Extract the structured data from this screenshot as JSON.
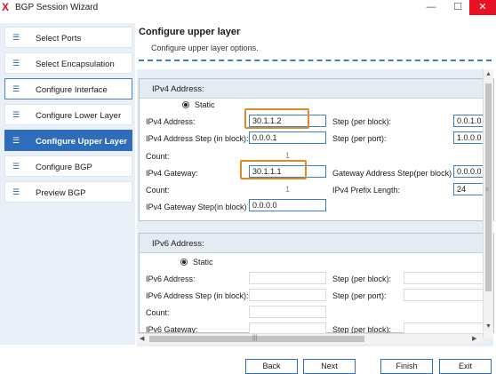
{
  "window": {
    "title": "BGP Session Wizard",
    "app_icon": "X",
    "minimize": "—",
    "maximize": "☐",
    "close": "✕"
  },
  "sidebar": {
    "items": [
      {
        "label": "Select Ports",
        "icon": "list-icon"
      },
      {
        "label": "Select Encapsulation",
        "icon": "list-icon"
      },
      {
        "label": "Configure Interface",
        "icon": "list-icon"
      },
      {
        "label": "Configure Lower Layer",
        "icon": "list-icon"
      },
      {
        "label": "Configure Upper Layer",
        "icon": "list-icon"
      },
      {
        "label": "Configure BGP",
        "icon": "list-icon"
      },
      {
        "label": "Preview BGP",
        "icon": "list-icon"
      }
    ],
    "icon_glyph": "☰",
    "active_index": 4
  },
  "header": {
    "title": "Configure upper layer",
    "subtitle": "Configure upper layer options."
  },
  "ipv4": {
    "title": "IPv4 Address:",
    "mode": "Static",
    "address_label": "IPv4 Address:",
    "address_value": "30.1.1.2",
    "step_block_label": "Step (per block):",
    "step_block_value": "0.0.1.0",
    "addr_step_inblock_label": "IPv4 Address Step (in block):",
    "addr_step_inblock_value": "0.0.0.1",
    "step_port_label": "Step (per port):",
    "step_port_value": "1.0.0.0",
    "count_label": "Count:",
    "count_value": "1",
    "gateway_label": "IPv4 Gateway:",
    "gateway_value": "30.1.1.1",
    "gw_step_block_label": "Gateway Address Step(per block)",
    "gw_step_block_value": "0.0.0.0",
    "count2_label": "Count:",
    "count2_value": "1",
    "prefix_label": "IPv4 Prefix Length:",
    "prefix_value": "24",
    "gw_step_inblock_label": "IPv4 Gateway Step(in block)",
    "gw_step_inblock_value": "0.0.0.0"
  },
  "ipv6": {
    "title": "IPv6 Address:",
    "mode": "Static",
    "address_label": "IPv6 Address:",
    "step_block_label": "Step (per block):",
    "addr_step_inblock_label": "IPv6 Address Step (in block):",
    "step_port_label": "Step (per port):",
    "count_label": "Count:",
    "gateway_label": "IPv6 Gateway:",
    "gw_step_block_label": "Step (per block):"
  },
  "buttons": {
    "back": "Back",
    "next": "Next",
    "finish": "Finish",
    "exit": "Exit"
  },
  "colors": {
    "accent": "#2f6dbb",
    "highlight": "#e0892b",
    "close": "#e81123"
  }
}
